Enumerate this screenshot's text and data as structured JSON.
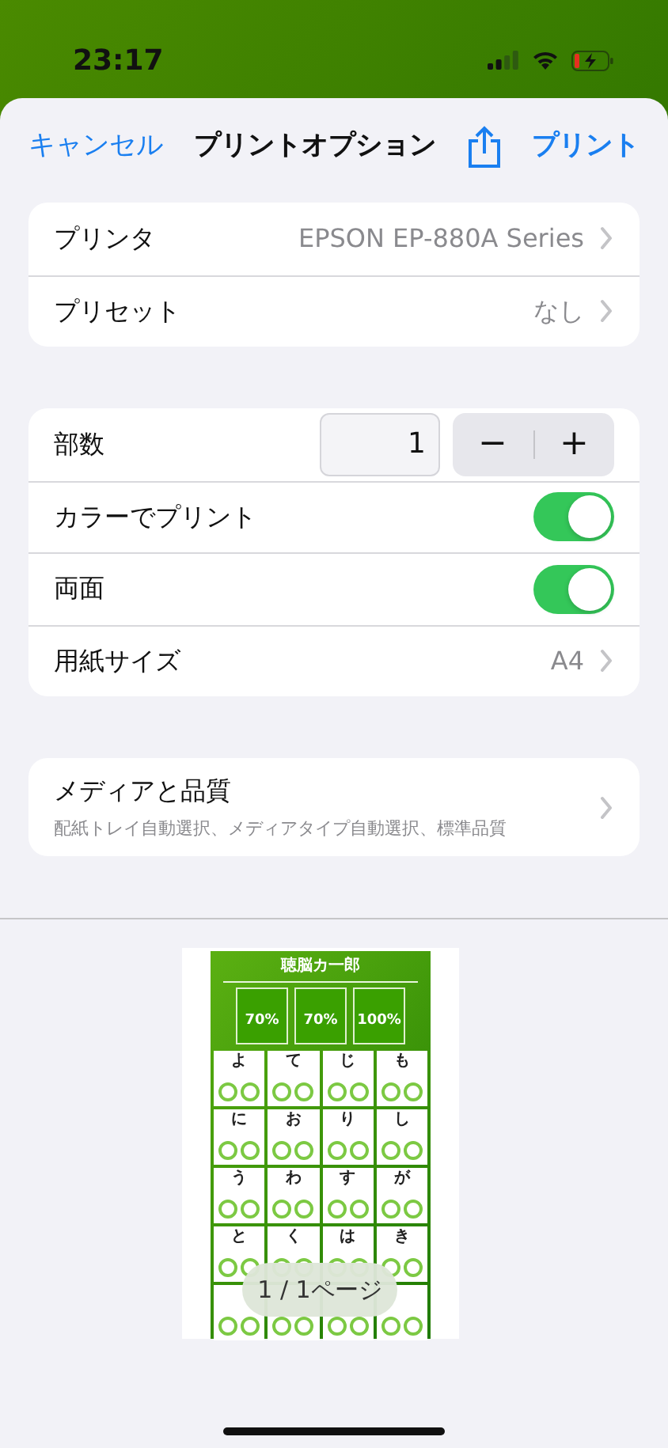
{
  "status_bar": {
    "time": "23:17"
  },
  "nav": {
    "cancel": "キャンセル",
    "title": "プリントオプション",
    "print": "プリント"
  },
  "groups": [
    {
      "rows": [
        {
          "kind": "link",
          "label": "プリンタ",
          "value": "EPSON EP-880A Series"
        },
        {
          "kind": "link",
          "label": "プリセット",
          "value": "なし"
        }
      ]
    },
    {
      "rows": [
        {
          "kind": "stepper",
          "label": "部数",
          "value": "1",
          "minus": "−",
          "plus": "+"
        },
        {
          "kind": "toggle",
          "label": "カラーでプリント",
          "on": true
        },
        {
          "kind": "toggle",
          "label": "両面",
          "on": true
        },
        {
          "kind": "link",
          "label": "用紙サイズ",
          "value": "A4"
        }
      ]
    },
    {
      "rows": [
        {
          "kind": "detail",
          "label": "メディアと品質",
          "subtitle": "配紙トレイ自動選択、メディアタイプ自動選択、標準品質"
        }
      ]
    }
  ],
  "preview": {
    "title": "聴脳カ一郎",
    "stats": [
      "70%",
      "70%",
      "100%"
    ],
    "cards": [
      {
        "kana": "よ"
      },
      {
        "kana": "て"
      },
      {
        "kana": "じ"
      },
      {
        "kana": "も"
      },
      {
        "kana": "に"
      },
      {
        "kana": "お"
      },
      {
        "kana": "り"
      },
      {
        "kana": "し"
      },
      {
        "kana": "う"
      },
      {
        "kana": "わ"
      },
      {
        "kana": "す"
      },
      {
        "kana": "が"
      },
      {
        "kana": "と"
      },
      {
        "kana": "く"
      },
      {
        "kana": "は"
      },
      {
        "kana": "き"
      },
      {
        "kind": "covered"
      },
      {
        "kind": "covered"
      },
      {
        "kind": "covered"
      },
      {
        "kind": "covered"
      }
    ],
    "page_indicator": "1 / 1ページ"
  }
}
